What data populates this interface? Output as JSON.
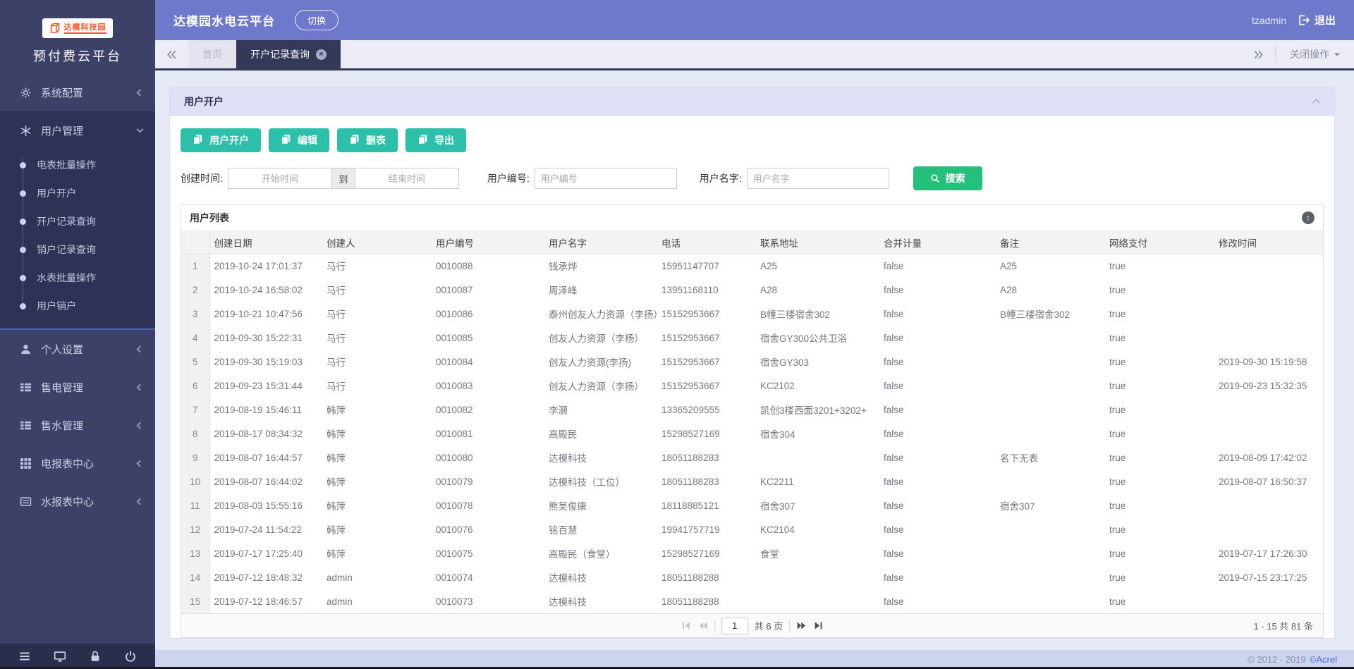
{
  "sidebar": {
    "logo_text": "达模科技园",
    "platform_title": "预付费云平台",
    "menu": [
      {
        "label": "系统配置",
        "icon": "gear",
        "expanded": false
      },
      {
        "label": "用户管理",
        "icon": "asterisk",
        "expanded": true,
        "children": [
          "电表批量操作",
          "用户开户",
          "开户记录查询",
          "销户记录查询",
          "水表批量操作",
          "用户销户"
        ]
      },
      {
        "label": "个人设置",
        "icon": "user",
        "expanded": false
      },
      {
        "label": "售电管理",
        "icon": "list",
        "expanded": false
      },
      {
        "label": "售水管理",
        "icon": "list",
        "expanded": false
      },
      {
        "label": "电报表中心",
        "icon": "grid",
        "expanded": false
      },
      {
        "label": "水报表中心",
        "icon": "report",
        "expanded": false
      }
    ]
  },
  "header": {
    "title": "达模园水电云平台",
    "switch_label": "切换",
    "username": "tzadmin",
    "logout_label": "退出"
  },
  "tabbar": {
    "tabs": [
      {
        "label": "首页",
        "active": false,
        "closable": false
      },
      {
        "label": "开户记录查询",
        "active": true,
        "closable": true
      }
    ],
    "close_menu_label": "关闭操作"
  },
  "panel": {
    "title": "用户开户"
  },
  "toolbar": {
    "buttons": [
      "用户开户",
      "编辑",
      "删表",
      "导出"
    ]
  },
  "search": {
    "created_label": "创建时间:",
    "start_placeholder": "开始时间",
    "to_label": "到",
    "end_placeholder": "结束时间",
    "user_no_label": "用户编号:",
    "user_no_placeholder": "用户编号",
    "user_name_label": "用户名字:",
    "user_name_placeholder": "用户名字",
    "search_label": "搜索"
  },
  "list": {
    "title": "用户列表",
    "columns": [
      "创建日期",
      "创建人",
      "用户编号",
      "用户名字",
      "电话",
      "联系地址",
      "合并计量",
      "备注",
      "网络支付",
      "修改时间"
    ],
    "rows": [
      [
        "2019-10-24 17:01:37",
        "马行",
        "0010088",
        "钱承烨",
        "15951147707",
        "A25",
        "false",
        "A25",
        "true",
        ""
      ],
      [
        "2019-10-24 16:58:02",
        "马行",
        "0010087",
        "周泽峰",
        "13951168110",
        "A28",
        "false",
        "A28",
        "true",
        ""
      ],
      [
        "2019-10-21 10:47:56",
        "马行",
        "0010086",
        "泰州创友人力资源（李扬）",
        "15152953667",
        "B幢三楼宿舍302",
        "false",
        "B幢三楼宿舍302",
        "true",
        ""
      ],
      [
        "2019-09-30 15:22:31",
        "马行",
        "0010085",
        "创友人力资源（李杨）",
        "15152953667",
        "宿舍GY300公共卫浴",
        "false",
        "",
        "true",
        ""
      ],
      [
        "2019-09-30 15:19:03",
        "马行",
        "0010084",
        "创友人力资源(李扬)",
        "15152953667",
        "宿舍GY303",
        "false",
        "",
        "true",
        "2019-09-30 15:19:58"
      ],
      [
        "2019-09-23 15:31:44",
        "马行",
        "0010083",
        "创友人力资源（李扬）",
        "15152953667",
        "KC2102",
        "false",
        "",
        "true",
        "2019-09-23 15:32:35"
      ],
      [
        "2019-08-19 15:46:11",
        "韩萍",
        "0010082",
        "李灏",
        "13365209555",
        "凯创3楼西面3201+3202+",
        "false",
        "",
        "true",
        ""
      ],
      [
        "2019-08-17 08:34:32",
        "韩萍",
        "0010081",
        "高殿民",
        "15298527169",
        "宿舍304",
        "false",
        "",
        "true",
        ""
      ],
      [
        "2019-08-07 16:44:57",
        "韩萍",
        "0010080",
        "达模科技",
        "18051188283",
        "",
        "false",
        "名下无表",
        "true",
        "2019-08-09 17:42:02"
      ],
      [
        "2019-08-07 16:44:02",
        "韩萍",
        "0010079",
        "达模科技（工位）",
        "18051188283",
        "KC2211",
        "false",
        "",
        "true",
        "2019-08-07 16:50:37"
      ],
      [
        "2019-08-03 15:55:16",
        "韩萍",
        "0010078",
        "熊吴俊康",
        "18118885121",
        "宿舍307",
        "false",
        "宿舍307",
        "true",
        ""
      ],
      [
        "2019-07-24 11:54:22",
        "韩萍",
        "0010076",
        "铭百慧",
        "19941757719",
        "KC2104",
        "false",
        "",
        "true",
        ""
      ],
      [
        "2019-07-17 17:25:40",
        "韩萍",
        "0010075",
        "高殿民（食堂）",
        "15298527169",
        "食堂",
        "false",
        "",
        "true",
        "2019-07-17 17:26:30"
      ],
      [
        "2019-07-12 18:48:32",
        "admin",
        "0010074",
        "达模科技",
        "18051188288",
        "",
        "false",
        "",
        "true",
        "2019-07-15 23:17:25"
      ],
      [
        "2019-07-12 18:46:57",
        "admin",
        "0010073",
        "达模科技",
        "18051188288",
        "",
        "false",
        "",
        "true",
        ""
      ]
    ]
  },
  "pagination": {
    "page": "1",
    "pages_label": "共 6 页",
    "range_label": "1 - 15  共 81 条"
  },
  "footer": {
    "copyright": "© 2012 - 2019",
    "brand": "©Acrel"
  },
  "colors": {
    "accent_teal": "#2cbfa9",
    "accent_green": "#25c17c",
    "header_purple": "#6e79cc",
    "sidebar_navy": "#3d4167",
    "tab_active": "#343859"
  }
}
